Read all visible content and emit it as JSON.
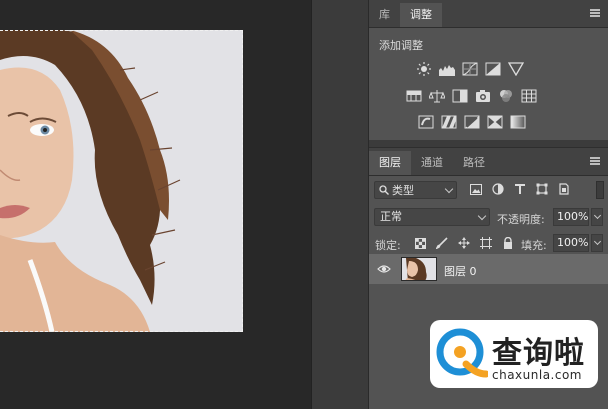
{
  "adjustments_panel": {
    "tabs": [
      {
        "label": "库",
        "active": false
      },
      {
        "label": "调整",
        "active": true
      }
    ],
    "title": "添加调整",
    "row1_icons": [
      "brightness-icon",
      "levels-icon",
      "curves-icon",
      "exposure-icon",
      "vibrance-icon"
    ],
    "row2_icons": [
      "hue-saturation-icon",
      "color-balance-icon",
      "black-white-icon",
      "photo-filter-icon",
      "channel-mixer-icon",
      "color-lookup-icon"
    ],
    "row3_icons": [
      "invert-icon",
      "posterize-icon",
      "threshold-icon",
      "selective-color-icon",
      "gradient-map-icon"
    ]
  },
  "layers_panel": {
    "tabs": [
      {
        "label": "图层",
        "active": true
      },
      {
        "label": "通道",
        "active": false
      },
      {
        "label": "路径",
        "active": false
      }
    ],
    "filter_label": "类型",
    "filter_icons": [
      "image-filter-icon",
      "adjustment-filter-icon",
      "type-filter-icon",
      "shape-filter-icon",
      "smart-object-filter-icon"
    ],
    "blend_mode": "正常",
    "opacity_label": "不透明度:",
    "opacity_value": "100%",
    "lock_label": "锁定:",
    "fill_label": "填充:",
    "fill_value": "100%",
    "layers": [
      {
        "name": "图层 0",
        "visible": true,
        "selected": true
      }
    ]
  },
  "watermark": {
    "name": "查询啦",
    "url": "chaxunla.com"
  },
  "colors": {
    "canvas_bg": "#282828",
    "document_bg": "#e2e2e6",
    "panel_bg": "#535353",
    "selected_layer": "#6a6a6a",
    "watermark_blue": "#1e8fd6"
  }
}
